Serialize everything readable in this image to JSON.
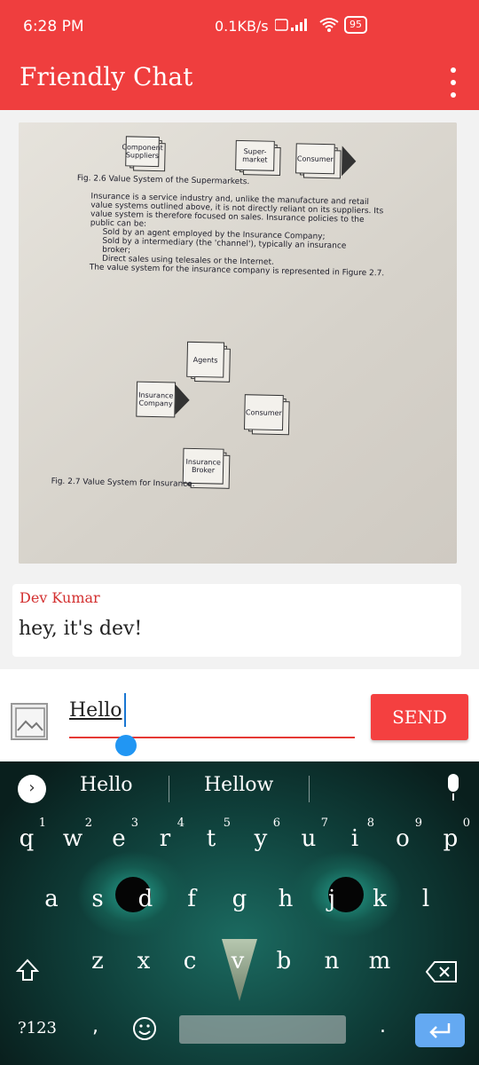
{
  "status_bar": {
    "time": "6:28 PM",
    "network_speed": "0.1KB/s",
    "battery": "95"
  },
  "app_bar": {
    "title": "Friendly Chat"
  },
  "photo": {
    "fig1_boxes": [
      "Component Suppliers",
      "Super- market",
      "Consumer"
    ],
    "fig1_caption": "Fig. 2.6  Value System of the Supermarkets.",
    "paragraph": [
      "Insurance is a service industry and, unlike the manufacture and retail",
      "value systems outlined above, it is not directly reliant on its suppliers. Its",
      "value system is therefore focused on sales.  Insurance policies to the",
      "public can be:",
      "Sold by an agent employed by the Insurance Company;",
      "Sold by a intermediary (the 'channel'), typically an insurance",
      "broker;",
      "Direct sales using telesales or the Internet.",
      "The value system for the insurance company is represented in Figure 2.7."
    ],
    "fig2_boxes": {
      "agents": "Agents",
      "company": "Insurance Company",
      "consumer": "Consumer",
      "broker": "Insurance Broker"
    },
    "fig2_caption": "Fig. 2.7  Value System for Insurance."
  },
  "message": {
    "sender": "Dev Kumar",
    "text": "hey, it's dev!"
  },
  "composer": {
    "input_value": "Hello",
    "send_label": "SEND"
  },
  "keyboard": {
    "suggestions": [
      "Hello",
      "Hellow"
    ],
    "row1": [
      {
        "k": "q",
        "n": "1"
      },
      {
        "k": "w",
        "n": "2"
      },
      {
        "k": "e",
        "n": "3"
      },
      {
        "k": "r",
        "n": "4"
      },
      {
        "k": "t",
        "n": "5"
      },
      {
        "k": "y",
        "n": "6"
      },
      {
        "k": "u",
        "n": "7"
      },
      {
        "k": "i",
        "n": "8"
      },
      {
        "k": "o",
        "n": "9"
      },
      {
        "k": "p",
        "n": "0"
      }
    ],
    "row2": [
      "a",
      "s",
      "d",
      "f",
      "g",
      "h",
      "j",
      "k",
      "l"
    ],
    "row3": [
      "z",
      "x",
      "c",
      "v",
      "b",
      "n",
      "m"
    ],
    "symbols_label": "?123",
    "comma": ",",
    "period": "."
  },
  "colors": {
    "accent": "#ef3e3e",
    "send_button": "#f44040",
    "sender_name": "#d32f2f",
    "caret": "#1976d2",
    "enter_key": "#64a9f2"
  },
  "icons": [
    "wifi-icon",
    "signal-icon",
    "battery-icon",
    "overflow-menu-icon",
    "image-picker-icon",
    "expand-suggestions-icon",
    "mic-icon",
    "shift-icon",
    "backspace-icon",
    "emoji-icon",
    "enter-icon"
  ]
}
